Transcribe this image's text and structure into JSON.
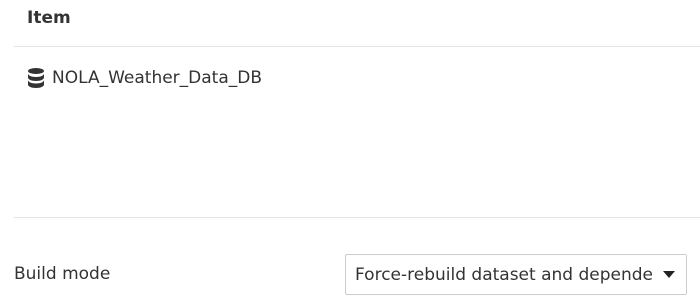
{
  "table": {
    "column_header": "Item",
    "rows": [
      {
        "icon": "database-icon",
        "name": "NOLA_Weather_Data_DB"
      }
    ]
  },
  "build_mode": {
    "label": "Build mode",
    "selected_value": "Force-rebuild dataset and dependencies",
    "icon": "caret-down-icon"
  }
}
